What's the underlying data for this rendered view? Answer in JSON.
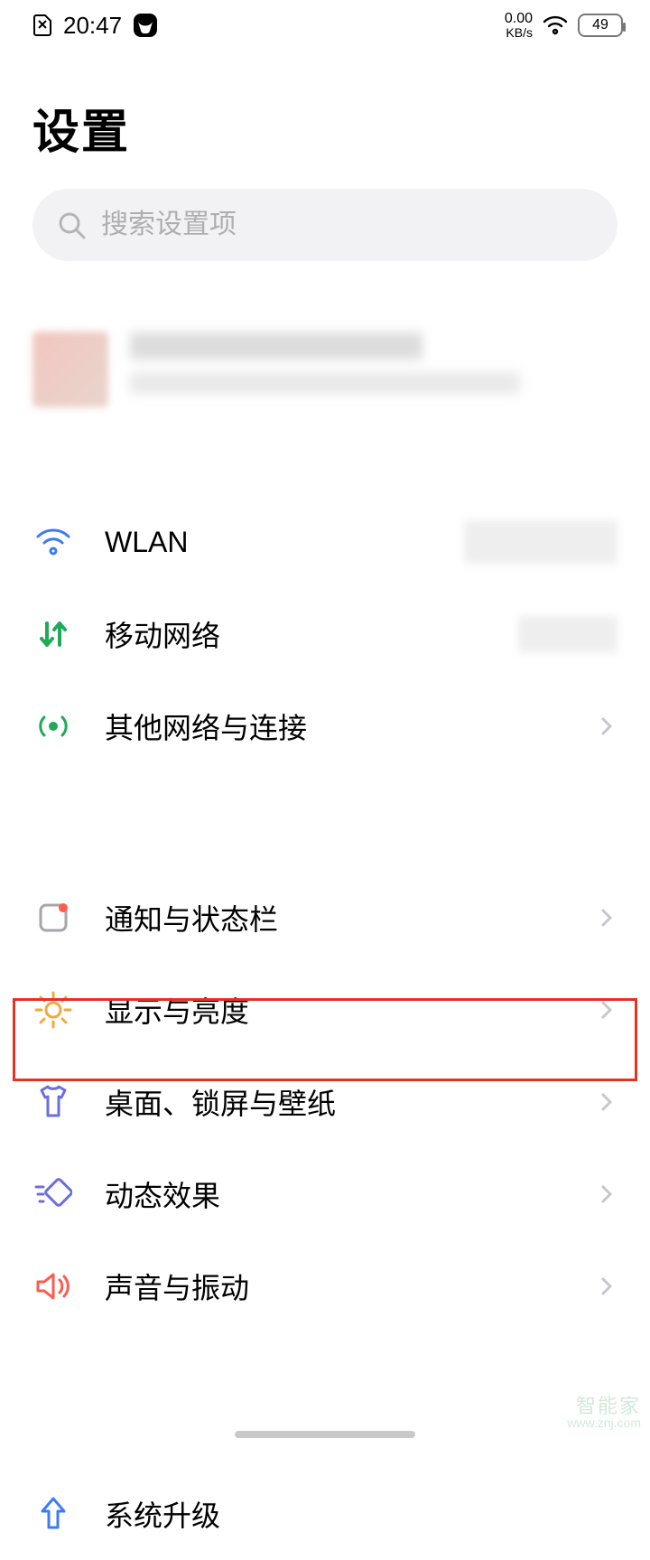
{
  "status": {
    "time": "20:47",
    "net_speed_value": "0.00",
    "net_speed_unit": "KB/s",
    "battery": "49"
  },
  "page": {
    "title": "设置"
  },
  "search": {
    "placeholder": "搜索设置项"
  },
  "sections": {
    "network": [
      {
        "key": "wlan",
        "label": "WLAN"
      },
      {
        "key": "mobile",
        "label": "移动网络"
      },
      {
        "key": "other_net",
        "label": "其他网络与连接"
      }
    ],
    "display": [
      {
        "key": "notify",
        "label": "通知与状态栏"
      },
      {
        "key": "brightness",
        "label": "显示与亮度"
      },
      {
        "key": "wallpaper",
        "label": "桌面、锁屏与壁纸"
      },
      {
        "key": "animation",
        "label": "动态效果"
      },
      {
        "key": "sound",
        "label": "声音与振动"
      }
    ],
    "system": [
      {
        "key": "upgrade",
        "label": "系统升级"
      }
    ]
  },
  "watermark": {
    "main": "智能家",
    "sub": "www.znj.com"
  }
}
